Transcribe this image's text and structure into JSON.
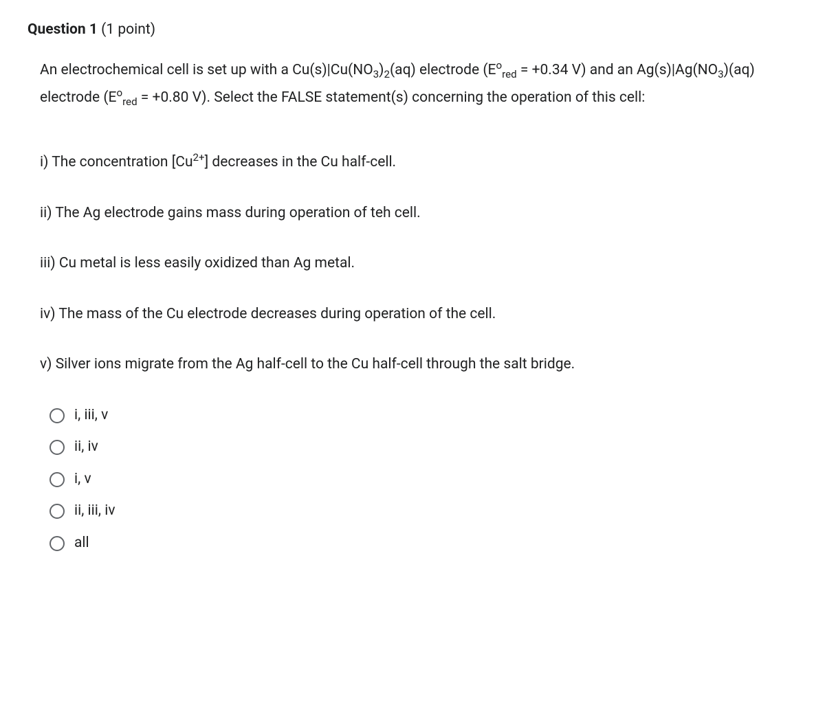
{
  "header": {
    "question_label": "Question 1",
    "points_label": " (1 point)"
  },
  "prompt": {
    "t1": "An electrochemical cell is set up with a Cu(s)|Cu(NO",
    "t2": "3",
    "t3": ")",
    "t4": "2",
    "t5": "(aq) electrode (E",
    "t6": "o",
    "t7": "red",
    "t8": " = +0.34 V) and an Ag(s)|Ag(NO",
    "t9": "3",
    "t10": ")(aq) electrode (E",
    "t11": "o",
    "t12": "red",
    "t13": " = +0.80 V). Select the FALSE statement(s) concerning the operation of this cell:"
  },
  "statements": {
    "s1a": "i) The concentration [Cu",
    "s1b": "2+",
    "s1c": "] decreases in the Cu half-cell.",
    "s2": "ii) The Ag electrode gains mass during operation of teh cell.",
    "s3": "iii) Cu metal is less easily oxidized than Ag metal.",
    "s4": "iv) The mass of the Cu electrode decreases during operation of the cell.",
    "s5": "v) Silver ions migrate from the Ag half-cell to the Cu half-cell through the salt bridge."
  },
  "options": [
    "i, iii, v",
    "ii, iv",
    "i, v",
    "ii, iii, iv",
    "all"
  ]
}
